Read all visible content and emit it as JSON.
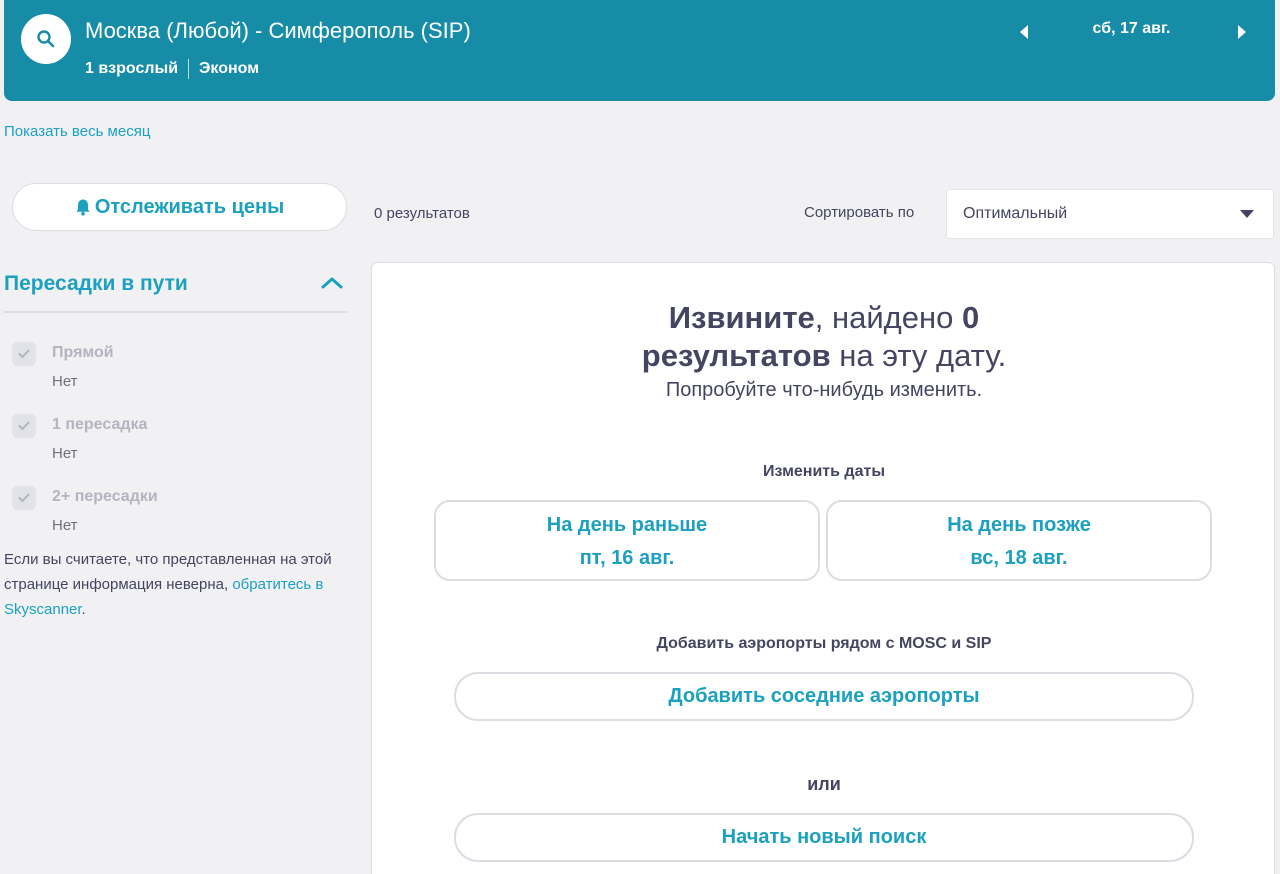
{
  "header": {
    "route": "Москва (Любой) - Симферополь (SIP)",
    "passengers": "1 взрослый",
    "cabin_class": "Эконом",
    "date": "сб, 17 авг."
  },
  "show_month_link": "Показать весь месяц",
  "sidebar": {
    "track_prices": "Отслеживать цены",
    "stops_title": "Пересадки в пути",
    "filters": [
      {
        "label": "Прямой",
        "value": "Нет",
        "checked": true
      },
      {
        "label": "1 пересадка",
        "value": "Нет",
        "checked": true
      },
      {
        "label": "2+ пересадки",
        "value": "Нет",
        "checked": true
      }
    ],
    "disclaimer_text": "Если вы считаете, что представленная на этой странице информация неверна,",
    "disclaimer_link": "обратитесь в Skyscanner",
    "disclaimer_end": "."
  },
  "results": {
    "count": "0 результатов",
    "sort_label": "Сортировать по",
    "sort_value": "Оптимальный"
  },
  "no_results": {
    "sorry_bold1": "Извините",
    "sorry_text1": ", найдено ",
    "sorry_bold2": "0",
    "sorry_bold3": "результатов",
    "sorry_text2": " на эту дату.",
    "try_change": "Попробуйте что-нибудь изменить.",
    "change_dates_title": "Изменить даты",
    "earlier_label": "На день раньше",
    "earlier_date": "пт, 16 авг.",
    "later_label": "На день позже",
    "later_date": "вс, 18 авг.",
    "add_airports_title": "Добавить аэропорты рядом с MOSC и SIP",
    "add_airports_button": "Добавить соседние аэропорты",
    "or_text": "или",
    "new_search_button": "Начать новый поиск"
  },
  "colors": {
    "header_bg": "#178ca7",
    "accent": "#1ba0c0",
    "text": "#444560",
    "page_bg": "#f1f1f4"
  },
  "icons": {
    "search": "search-icon",
    "prev": "caret-left-icon",
    "next": "caret-right-icon",
    "bell": "bell-icon",
    "collapse": "chevron-up-icon",
    "check": "check-icon",
    "dropdown": "caret-down-icon"
  }
}
